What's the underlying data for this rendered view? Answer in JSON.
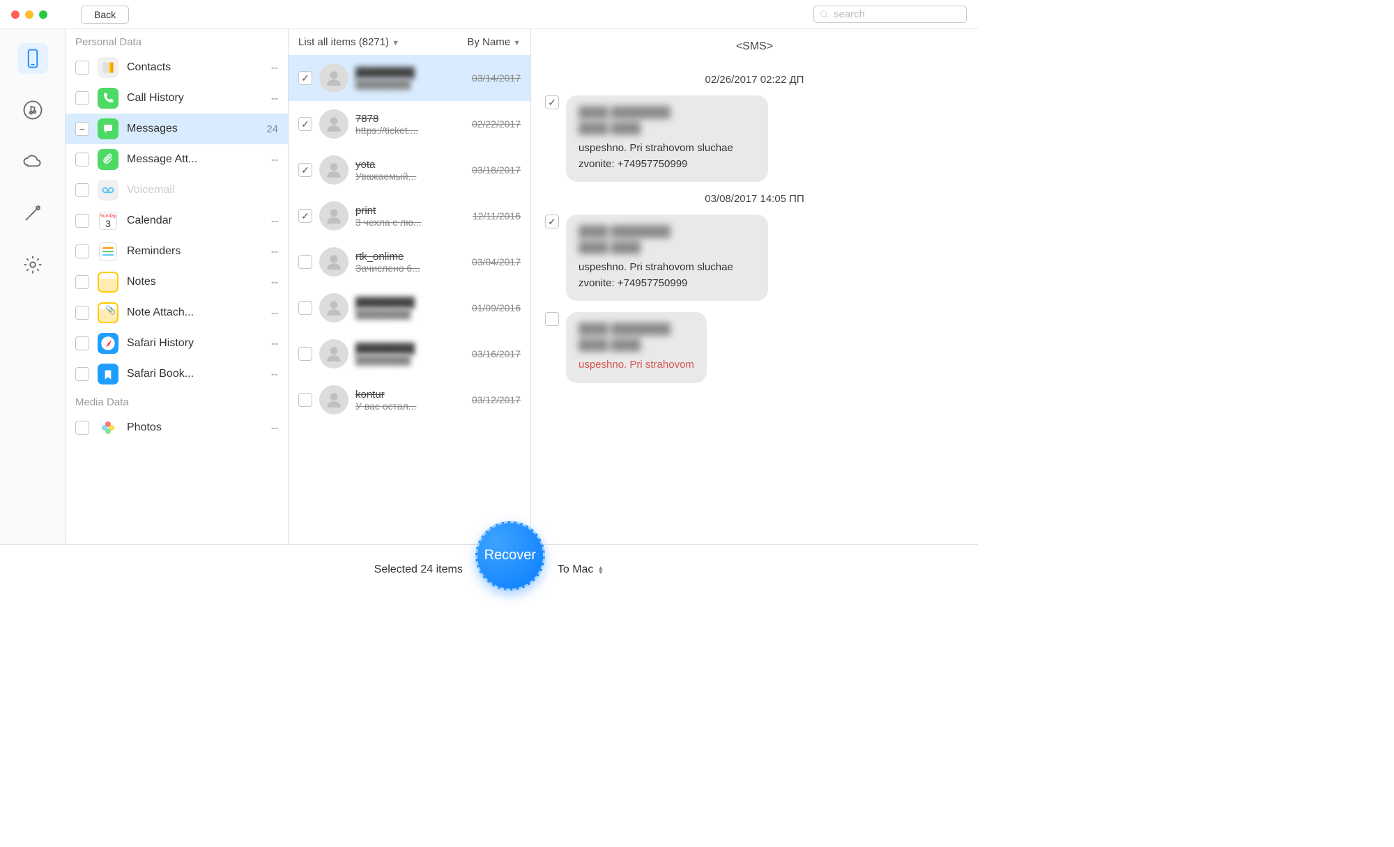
{
  "header": {
    "back_label": "Back",
    "search_placeholder": "search"
  },
  "sidebar_nav": [
    "device",
    "media",
    "cloud",
    "tools",
    "settings"
  ],
  "categories": {
    "section1_title": "Personal Data",
    "section2_title": "Media Data",
    "items": [
      {
        "label": "Contacts",
        "count": "--",
        "icon": "contacts",
        "iconbg": "#f0f0f0"
      },
      {
        "label": "Call History",
        "count": "--",
        "icon": "phone",
        "iconbg": "#4cd964"
      },
      {
        "label": "Messages",
        "count": "24",
        "icon": "chat",
        "iconbg": "#4cd964",
        "checked": "minus",
        "active": true
      },
      {
        "label": "Message Att...",
        "count": "--",
        "icon": "attach",
        "iconbg": "#4cd964"
      },
      {
        "label": "Voicemail",
        "count": "",
        "icon": "voicemail",
        "iconbg": "#f0f0f0",
        "disabled": true
      },
      {
        "label": "Calendar",
        "count": "--",
        "icon": "calendar",
        "iconbg": "#fff"
      },
      {
        "label": "Reminders",
        "count": "--",
        "icon": "reminders",
        "iconbg": "#fff"
      },
      {
        "label": "Notes",
        "count": "--",
        "icon": "notes",
        "iconbg": "#ffcc00"
      },
      {
        "label": "Note Attach...",
        "count": "--",
        "icon": "noteattach",
        "iconbg": "#ffcc00"
      },
      {
        "label": "Safari History",
        "count": "--",
        "icon": "safari",
        "iconbg": "#1e9fff"
      },
      {
        "label": "Safari Book...",
        "count": "--",
        "icon": "safaribook",
        "iconbg": "#1e9fff"
      }
    ],
    "media_items": [
      {
        "label": "Photos",
        "count": "--",
        "icon": "photos",
        "iconbg": "#fff"
      }
    ]
  },
  "message_list": {
    "filter_label": "List all items (8271)",
    "sort_label": "By Name",
    "rows": [
      {
        "name": "████████",
        "preview": "████████",
        "date": "03/14/2017",
        "checked": true,
        "selected": true,
        "blurred": true
      },
      {
        "name": "7878",
        "preview": "https://ticket....",
        "date": "02/22/2017",
        "checked": true
      },
      {
        "name": "yota",
        "preview": "Уважаемый...",
        "date": "03/18/2017",
        "checked": true
      },
      {
        "name": "print",
        "preview": "3 чехла с лю...",
        "date": "12/11/2016",
        "checked": true
      },
      {
        "name": "rtk_onlime",
        "preview": "Зачислено 6...",
        "date": "03/04/2017",
        "checked": false
      },
      {
        "name": "████████",
        "preview": "████████",
        "date": "01/09/2016",
        "checked": false,
        "blurred": true
      },
      {
        "name": "████████",
        "preview": "████████",
        "date": "03/16/2017",
        "checked": false,
        "blurred": true
      },
      {
        "name": "kontur",
        "preview": "У вас остал...",
        "date": "03/12/2017",
        "checked": false
      }
    ]
  },
  "detail": {
    "title": "<SMS>",
    "blocks": [
      {
        "type": "time",
        "text": "02/26/2017 02:22 ДП"
      },
      {
        "type": "bubble",
        "checked": true,
        "blur": "████ ████████\n████ ████",
        "body": "uspeshno. Pri strahovom sluchae zvonite: +74957750999"
      },
      {
        "type": "time",
        "text": "03/08/2017 14:05 ПП"
      },
      {
        "type": "bubble",
        "checked": true,
        "blur": "████ ████████\n████ ████",
        "body": "uspeshno. Pri strahovom sluchae zvonite: +74957750999"
      },
      {
        "type": "bubble",
        "checked": false,
        "red": true,
        "blur": "████ ████████\n████ ████",
        "body": "uspeshno. Pri strahovom"
      }
    ]
  },
  "footer": {
    "selected_text": "Selected 24 items",
    "recover_label": "Recover",
    "dest_label": "To Mac"
  }
}
